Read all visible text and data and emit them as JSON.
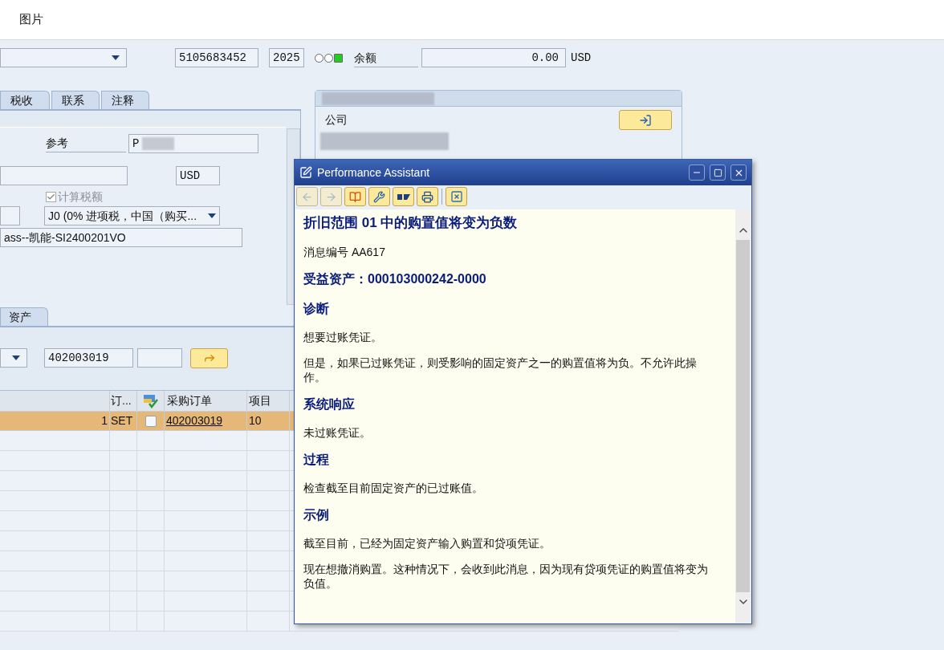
{
  "window": {
    "title": "图片"
  },
  "header": {
    "document_number": "5105683452",
    "fiscal_year": "2025",
    "lights": [
      {
        "on": false
      },
      {
        "on": false
      },
      {
        "on": true
      }
    ],
    "balance_label": "余额",
    "balance": "0.00",
    "balance_currency": "USD"
  },
  "top_tabs": [
    {
      "label": "税收",
      "selected": false
    },
    {
      "label": "联系",
      "selected": false
    },
    {
      "label": "注释",
      "selected": false
    }
  ],
  "basic_data": {
    "reference_label": "参考",
    "reference": "P",
    "currency": "USD",
    "calc_tax": {
      "label": "计算税额",
      "checked": true,
      "disabled": true
    },
    "tax_code": "J0 (0% 进项税，中国（购买...",
    "text": "ass--凯能-SI2400201VO"
  },
  "vendor_panel": {
    "company_label": "公司"
  },
  "item_tabs": [
    {
      "label": "资产",
      "selected": false
    }
  ],
  "po_reference": {
    "po_number": "402003019"
  },
  "items_table": {
    "columns": [
      "订...",
      "采购订单",
      "项目"
    ],
    "rows": [
      {
        "quantity": "1",
        "unit": "SET",
        "checked": false,
        "po": "402003019",
        "item": "10",
        "selected": true
      }
    ]
  },
  "dialog": {
    "title": "Performance Assistant",
    "blocks": [
      {
        "kind": "title",
        "text": "折旧范围 01 中的购置值将变为负数"
      },
      {
        "kind": "para",
        "text": "消息编号 AA617"
      },
      {
        "kind": "heading",
        "text": "受益资产：000103000242-0000"
      },
      {
        "kind": "heading",
        "text": "诊断"
      },
      {
        "kind": "para",
        "text": "想要过账凭证。"
      },
      {
        "kind": "para",
        "text": "但是，如果已过账凭证，则受影响的固定资产之一的购置值将为负。不允许此操作。"
      },
      {
        "kind": "heading",
        "text": "系统响应"
      },
      {
        "kind": "para",
        "text": "未过账凭证。"
      },
      {
        "kind": "heading",
        "text": "过程"
      },
      {
        "kind": "para",
        "text": "检查截至目前固定资产的已过账值。"
      },
      {
        "kind": "heading",
        "text": "示例"
      },
      {
        "kind": "para",
        "text": "截至目前，已经为固定资产输入购置和贷项凭证。"
      },
      {
        "kind": "para",
        "text": "现在想撤消购置。这种情况下，会收到此消息，因为现有贷项凭证的购置值将变为负值。"
      }
    ]
  }
}
